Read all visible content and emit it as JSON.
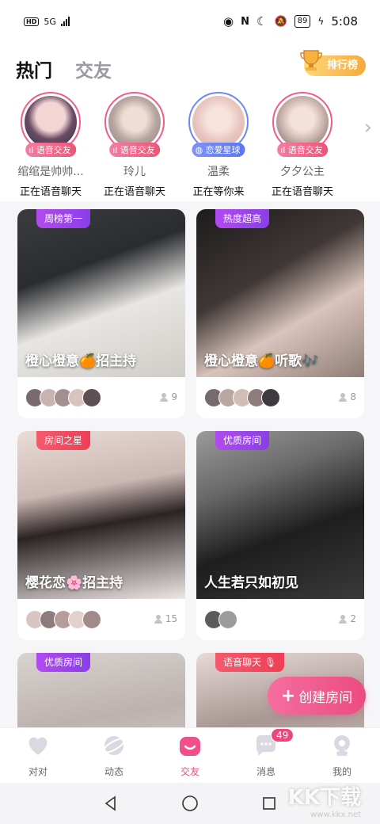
{
  "status_bar": {
    "hd": "HD",
    "net": "5G",
    "battery": "89",
    "time": "5:08"
  },
  "header": {
    "tab_hot": "热门",
    "tab_friends": "交友",
    "rank_label": "排行榜"
  },
  "stories": [
    {
      "badge": "语音交友",
      "name": "绾绾是帅帅...",
      "status": "正在语音聊天",
      "badge_color": "#ee5479"
    },
    {
      "badge": "语音交友",
      "name": "玲儿",
      "status": "正在语音聊天",
      "badge_color": "#ee5479"
    },
    {
      "badge": "恋爱星球",
      "name": "温柔",
      "status": "正在等你来",
      "badge_color": "#5a78ef"
    },
    {
      "badge": "语音交友",
      "name": "夕夕公主",
      "status": "正在语音聊天",
      "badge_color": "#ee5479"
    }
  ],
  "cards": [
    {
      "tag": "周榜第一",
      "title": "橙心橙意🍊招主持",
      "count": "9"
    },
    {
      "tag": "热度超高",
      "title": "橙心橙意🍊听歌🎶",
      "count": "8"
    },
    {
      "tag": "房间之星",
      "title": "樱花恋🌸招主持",
      "count": "15"
    },
    {
      "tag": "优质房间",
      "title": "人生若只如初见",
      "count": "2"
    },
    {
      "tag": "优质房间",
      "title": "",
      "count": ""
    },
    {
      "tag": "语音聊天",
      "title": "",
      "count": ""
    }
  ],
  "fab": {
    "label": "创建房间"
  },
  "bottom_nav": [
    {
      "label": "对对"
    },
    {
      "label": "动态"
    },
    {
      "label": "交友"
    },
    {
      "label": "消息",
      "badge": "49"
    },
    {
      "label": "我的"
    }
  ],
  "watermark": {
    "main": "KK下载",
    "url": "www.kkx.net"
  },
  "colors": {
    "accent": "#ee4d85",
    "tag_purple": "#8a3ee8",
    "tag_red": "#ef3e56",
    "rank": "#f7a93b"
  }
}
